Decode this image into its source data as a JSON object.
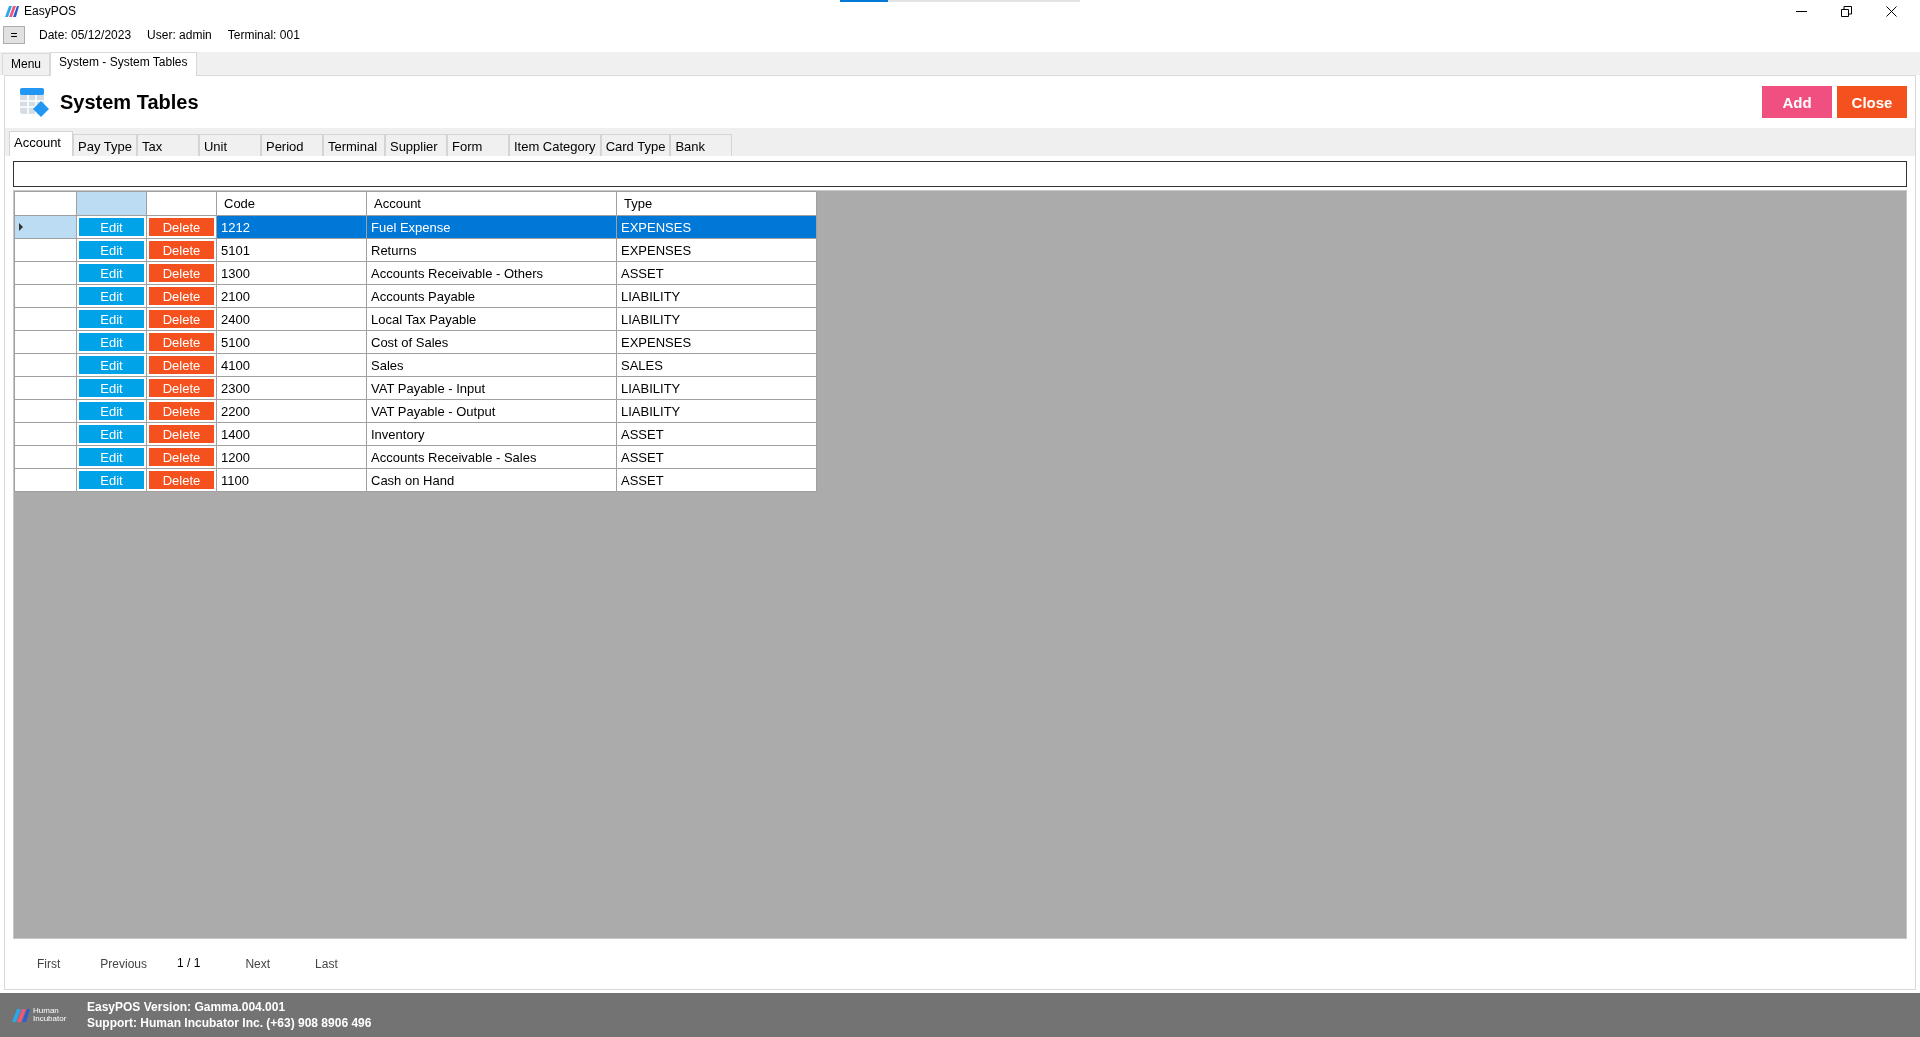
{
  "window": {
    "title": "EasyPOS"
  },
  "loading_bar": {
    "level": 0.2
  },
  "info_bar": {
    "menu_button": "=",
    "date": "Date: 05/12/2023",
    "user": "User: admin",
    "terminal": "Terminal: 001"
  },
  "document_tabs": [
    {
      "label": "Menu",
      "selected": false
    },
    {
      "label": "System - System Tables",
      "selected": true
    }
  ],
  "page": {
    "title": "System Tables",
    "buttons": [
      {
        "label": "Add",
        "kind": "add"
      },
      {
        "label": "Close",
        "kind": "close"
      }
    ]
  },
  "table_tabs": [
    {
      "label": "Account",
      "selected": true
    },
    {
      "label": "Pay Type",
      "selected": false
    },
    {
      "label": "Tax",
      "selected": false
    },
    {
      "label": "Unit",
      "selected": false
    },
    {
      "label": "Period",
      "selected": false
    },
    {
      "label": "Terminal",
      "selected": false
    },
    {
      "label": "Supplier",
      "selected": false
    },
    {
      "label": "Form",
      "selected": false
    },
    {
      "label": "Item Category",
      "selected": false
    },
    {
      "label": "Card Type",
      "selected": false
    },
    {
      "label": "Bank",
      "selected": false
    }
  ],
  "table": {
    "columns": [
      "Code",
      "Account",
      "Type"
    ],
    "rows": [
      {
        "edit": "Edit",
        "delete": "Delete",
        "code": "1212",
        "account": "Fuel Expense",
        "type": "EXPENSES",
        "selected": true
      },
      {
        "edit": "Edit",
        "delete": "Delete",
        "code": "5101",
        "account": "Returns",
        "type": "EXPENSES",
        "selected": false
      },
      {
        "edit": "Edit",
        "delete": "Delete",
        "code": "1300",
        "account": "Accounts Receivable - Others",
        "type": "ASSET",
        "selected": false
      },
      {
        "edit": "Edit",
        "delete": "Delete",
        "code": "2100",
        "account": "Accounts Payable",
        "type": "LIABILITY",
        "selected": false
      },
      {
        "edit": "Edit",
        "delete": "Delete",
        "code": "2400",
        "account": "Local Tax Payable",
        "type": "LIABILITY",
        "selected": false
      },
      {
        "edit": "Edit",
        "delete": "Delete",
        "code": "5100",
        "account": "Cost of Sales",
        "type": "EXPENSES",
        "selected": false
      },
      {
        "edit": "Edit",
        "delete": "Delete",
        "code": "4100",
        "account": "Sales",
        "type": "SALES",
        "selected": false
      },
      {
        "edit": "Edit",
        "delete": "Delete",
        "code": "2300",
        "account": "VAT Payable - Input",
        "type": "LIABILITY",
        "selected": false
      },
      {
        "edit": "Edit",
        "delete": "Delete",
        "code": "2200",
        "account": "VAT Payable - Output",
        "type": "LIABILITY",
        "selected": false
      },
      {
        "edit": "Edit",
        "delete": "Delete",
        "code": "1400",
        "account": "Inventory",
        "type": "ASSET",
        "selected": false
      },
      {
        "edit": "Edit",
        "delete": "Delete",
        "code": "1200",
        "account": "Accounts Receivable - Sales",
        "type": "ASSET",
        "selected": false
      },
      {
        "edit": "Edit",
        "delete": "Delete",
        "code": "1100",
        "account": "Cash on Hand",
        "type": "ASSET",
        "selected": false
      }
    ]
  },
  "pager": {
    "first": "First",
    "previous": "Previous",
    "page": "1 / 1",
    "next": "Next",
    "last": "Last"
  },
  "footer": {
    "logo_text": [
      "Human",
      "Incubator"
    ],
    "version": "EasyPOS Version: Gamma.004.001",
    "support": "Support: Human Incubator Inc. (+63) 908 8906 496"
  }
}
